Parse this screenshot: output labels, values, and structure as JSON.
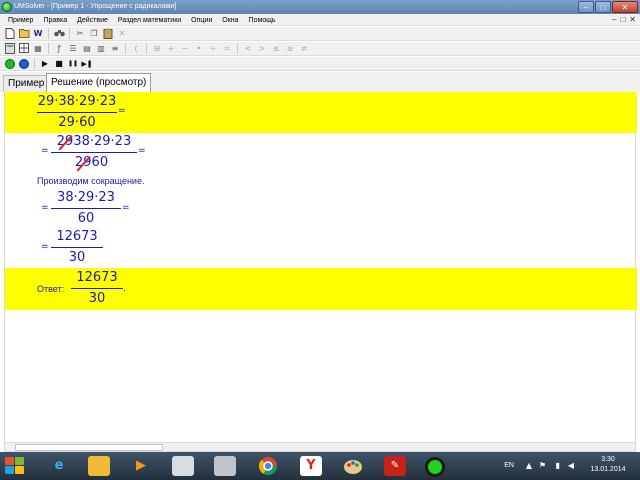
{
  "window": {
    "title": "UMSolver - [Пример 1 - Упрощение с радикалами]",
    "minimize": "–",
    "maximize": "□",
    "close": "✕"
  },
  "menu": {
    "items": [
      "Пример",
      "Правка",
      "Действие",
      "Раздел математики",
      "Опции",
      "Окна",
      "Помощь"
    ],
    "mdi": [
      "–",
      "□",
      "✕"
    ]
  },
  "toolbar1": [
    "new-doc-icon",
    "open-icon",
    "word-icon",
    "binoculars-icon",
    "cut-icon",
    "copy-icon",
    "paste-icon",
    "delete-icon"
  ],
  "toolbar2": {
    "labels": [
      "(",
      "+",
      "−",
      "•",
      "÷",
      "=",
      "<",
      ">",
      "≤",
      "≥",
      "≠"
    ]
  },
  "toolbar3": {
    "labels": [
      "▶",
      "■",
      "❚❚",
      "▶❚"
    ],
    "colors": {
      "circle_green": "#18c018",
      "circle_blue": "#1a5fd0"
    }
  },
  "tabs": {
    "example": "Пример",
    "solution": "Решение (просмотр)"
  },
  "solution": {
    "step1": {
      "num": "29·38·29·23",
      "den": "29·60",
      "eq": "="
    },
    "step2": {
      "eq_left": "=",
      "eq_right": "=",
      "num_struck": "29",
      "num_rest": "38·29·23",
      "den_struck": "29",
      "den_rest": "60"
    },
    "note": "Производим сокращение.",
    "step3": {
      "num": "38·29·23",
      "den": "60",
      "eq_left": "=",
      "eq_right": "="
    },
    "step4": {
      "num": "12673",
      "den": "30",
      "eq_left": "="
    },
    "answer": {
      "label": "Ответ:",
      "num": "12673",
      "den": "30",
      "dot": "."
    }
  },
  "colors": {
    "highlight": "#ffff00",
    "math_text": "#1a1ab8",
    "strike": "#e0202a"
  },
  "taskbar": {
    "apps": [
      "windows-logo-icon",
      "ie-icon",
      "folder-icon",
      "media-player-icon",
      "calculator-icon",
      "notepad-icon",
      "chrome-icon",
      "yandex-icon",
      "paint-icon",
      "pdf-icon",
      "umsolver-icon"
    ],
    "lang": "EN",
    "time": "3:30",
    "date": "13.01.2014"
  }
}
